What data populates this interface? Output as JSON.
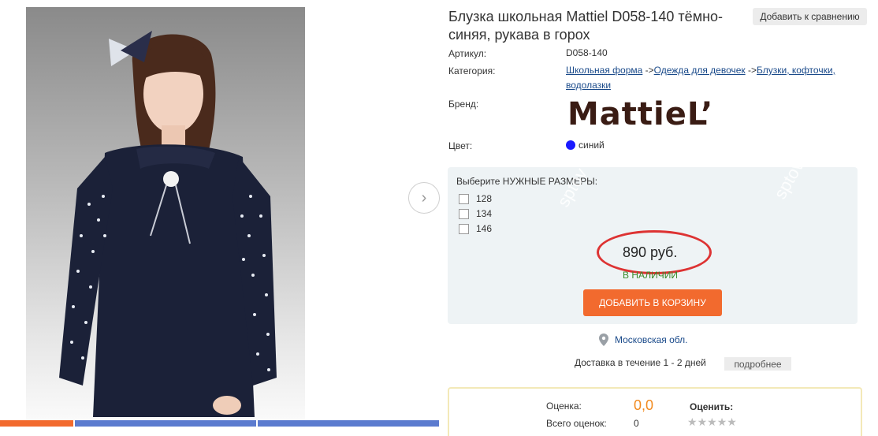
{
  "product": {
    "title": "Блузка школьная Mattiel D058-140 тёмно-синяя, рукава в горох",
    "compare_label": "Добавить к сравнению",
    "article_label": "Артикул:",
    "article_value": "D058-140",
    "category_label": "Категория:",
    "category_links": [
      "Школьная форма",
      "Одежда для девочек",
      "Блузки, кофточки, водолазки"
    ],
    "category_sep": " ->",
    "brand_label": "Бренд:",
    "brand_logo": "MattieL’",
    "color_label": "Цвет:",
    "color_value": "синий",
    "color_hex": "#1a1aff"
  },
  "buybox": {
    "size_title": "Выберите НУЖНЫЕ РАЗМЕРЫ:",
    "sizes": [
      "128",
      "134",
      "146"
    ],
    "price": "890 руб.",
    "stock": "В НАЛИЧИИ",
    "add_to_cart": "ДОБАВИТЬ В КОРЗИНУ",
    "accent": "#f26a2e"
  },
  "delivery": {
    "region": "Московская обл.",
    "text": "Доставка в течение 1 - 2 дней",
    "more": "подробнее"
  },
  "rating": {
    "score_label": "Оценка:",
    "score_value": "0,0",
    "count_label": "Всего оценок:",
    "count_value": "0",
    "rate_label": "Оценить:",
    "stars": "★★★★★"
  },
  "watermarks": [
    "sptov",
    "sptov"
  ],
  "icons": {
    "next": "chevron-right-icon",
    "region": "map-pin-icon",
    "star": "star-icon"
  }
}
